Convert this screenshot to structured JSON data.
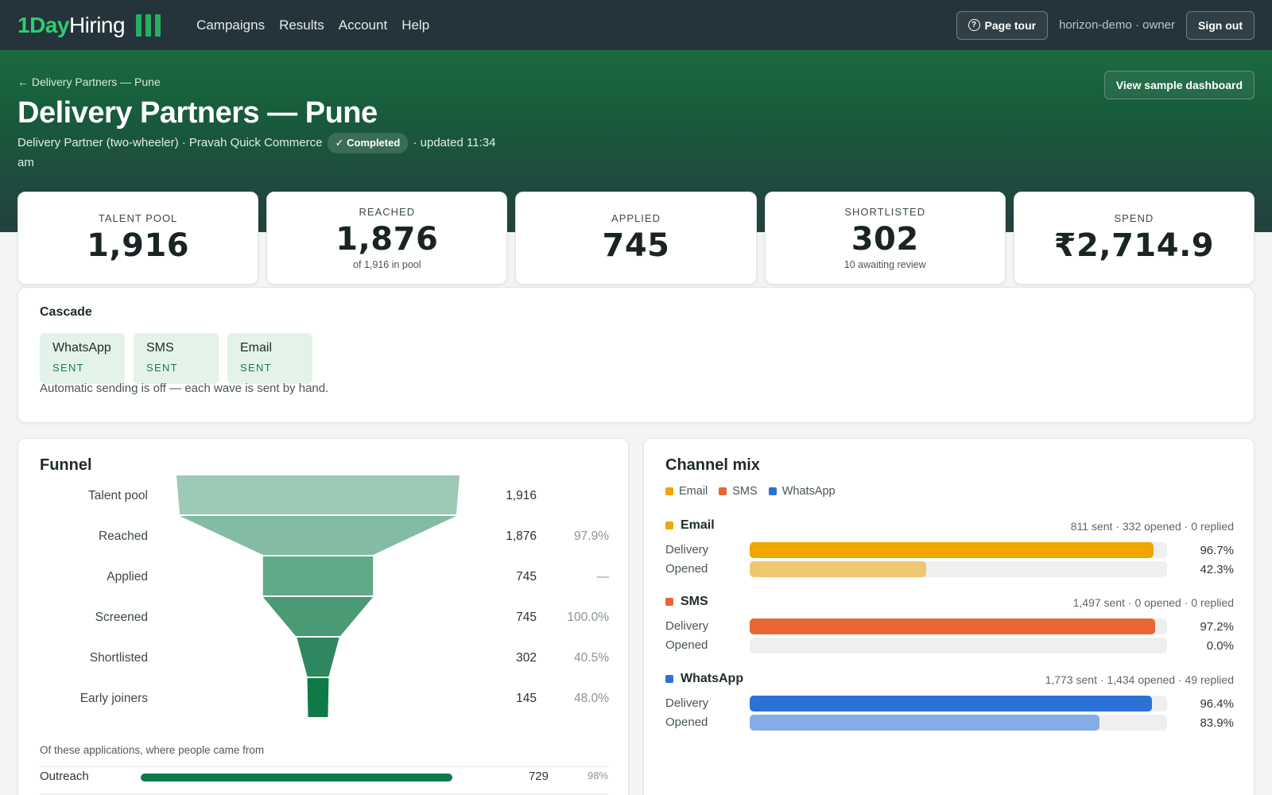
{
  "nav": {
    "brand_part1": "1Day",
    "brand_part2": "Hiring",
    "links": [
      "Campaigns",
      "Results",
      "Account",
      "Help"
    ],
    "page_tour_label": "Page tour",
    "user_text": "horizon-demo · owner",
    "sign_out_label": "Sign out"
  },
  "hero": {
    "breadcrumb": "← Delivery Partners — Pune",
    "title": "Delivery Partners — Pune",
    "role": "Delivery Partner (two-wheeler) · Pravah Quick Commerce",
    "status_badge": "✓ Completed",
    "updated": "· updated 11:34 am",
    "sample_dashboard_label": "View sample dashboard"
  },
  "kpis": [
    {
      "label": "TALENT POOL",
      "value": "1,916",
      "sub": ""
    },
    {
      "label": "REACHED",
      "value": "1,876",
      "sub": "of 1,916 in pool"
    },
    {
      "label": "APPLIED",
      "value": "745",
      "sub": ""
    },
    {
      "label": "SHORTLISTED",
      "value": "302",
      "sub": "10 awaiting review"
    },
    {
      "label": "SPEND",
      "value": "₹2,714.9",
      "sub": ""
    }
  ],
  "cascade": {
    "title": "Cascade",
    "chips": [
      {
        "name": "WhatsApp",
        "status": "SENT"
      },
      {
        "name": "SMS",
        "status": "SENT"
      },
      {
        "name": "Email",
        "status": "SENT"
      }
    ],
    "note": "Automatic sending is off — each wave is sent by hand."
  },
  "funnel": {
    "title": "Funnel",
    "stages": [
      {
        "label": "Talent pool",
        "count": "1,916",
        "pct": ""
      },
      {
        "label": "Reached",
        "count": "1,876",
        "pct": "97.9%"
      },
      {
        "label": "Applied",
        "count": "745",
        "pct": "—"
      },
      {
        "label": "Screened",
        "count": "745",
        "pct": "100.0%"
      },
      {
        "label": "Shortlisted",
        "count": "302",
        "pct": "40.5%"
      },
      {
        "label": "Early joiners",
        "count": "145",
        "pct": "48.0%"
      }
    ],
    "stage_values": [
      1916,
      1876,
      745,
      745,
      302,
      145
    ],
    "colors": [
      "#9ccab5",
      "#83bca2",
      "#62a987",
      "#4a9a74",
      "#2e875f",
      "#0f7a47"
    ],
    "source_note": "Of these applications, where people came from",
    "sources": [
      {
        "label": "Outreach",
        "count": "729",
        "pct": "98%",
        "fraction": 0.98
      }
    ]
  },
  "channel_mix": {
    "title": "Channel mix",
    "legend": [
      {
        "name": "Email",
        "color": "#f0a500"
      },
      {
        "name": "SMS",
        "color": "#e96535"
      },
      {
        "name": "WhatsApp",
        "color": "#2c72d6"
      }
    ],
    "delivery_label": "Delivery",
    "opened_label": "Opened",
    "channels": [
      {
        "name": "Email",
        "color": "#f0a500",
        "light": "#eec770",
        "stats": "811 sent · 332 opened · 0 replied",
        "delivery": 96.7,
        "delivery_text": "96.7%",
        "opened": 42.3,
        "opened_text": "42.3%"
      },
      {
        "name": "SMS",
        "color": "#e96535",
        "light": "#f2a07f",
        "stats": "1,497 sent · 0 opened · 0 replied",
        "delivery": 97.2,
        "delivery_text": "97.2%",
        "opened": 0.0,
        "opened_text": "0.0%"
      },
      {
        "name": "WhatsApp",
        "color": "#2c72d6",
        "light": "#84ade6",
        "stats": "1,773 sent · 1,434 opened · 49 replied",
        "delivery": 96.4,
        "delivery_text": "96.4%",
        "opened": 83.9,
        "opened_text": "83.9%"
      }
    ]
  }
}
